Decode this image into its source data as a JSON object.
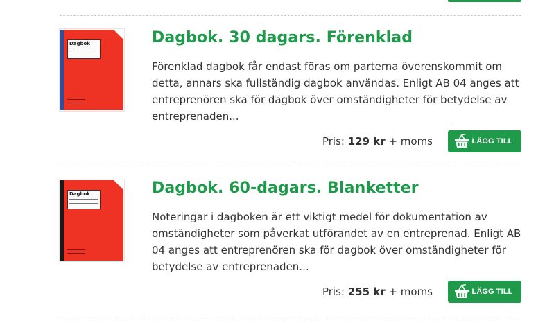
{
  "colors": {
    "accent_green": "#1f9a4b",
    "cover_red": "#ee3324",
    "text": "#333333"
  },
  "products": [
    {
      "title": "Dagbok. 30 dagars. Förenklad",
      "description": "Förenklad dagbok får endast föras om parterna överenskommit om detta, annars ska fullständig dagbok användas. Enligt AB 04 anges att entreprenören ska för dagbok över omständigheter för betydelse av entreprenaden...",
      "cover_label": "Dagbok",
      "spine_color": "#2b4fa8",
      "price_prefix": "Pris:",
      "price_amount": "129 kr",
      "price_suffix": "+ moms",
      "button_label": "LÄGG TILL",
      "button_icon": "basket-icon"
    },
    {
      "title": "Dagbok. 60-dagars. Blanketter",
      "description": "Noteringar i dagboken är ett viktigt medel för dokumentation av omständigheter som påverkat utförandet av en entreprenad. Enligt AB 04 anges att entreprenören ska för dagbok över omständigheter för betydelse av entreprenaden...",
      "cover_label": "Dagbok",
      "spine_color": "#1a1a1a",
      "price_prefix": "Pris:",
      "price_amount": "255 kr",
      "price_suffix": "+ moms",
      "button_label": "LÄGG TILL",
      "button_icon": "basket-icon"
    }
  ]
}
